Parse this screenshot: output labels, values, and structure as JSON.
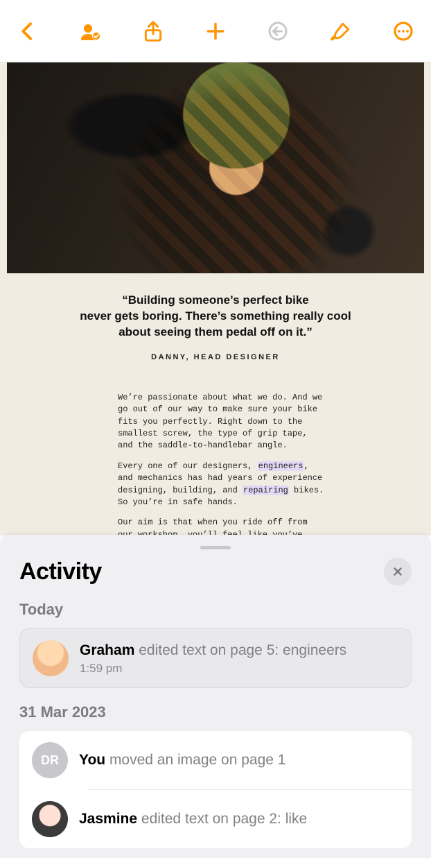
{
  "document": {
    "quote": {
      "line1": "“Building someone’s perfect bike",
      "line2": "never gets boring. There’s something really cool",
      "line3": "about seeing them pedal off on it.”",
      "attribution": "DANNY, HEAD DESIGNER"
    },
    "paragraphs": {
      "p1": "We’re passionate about what we do. And we go out of our way to make sure your bike fits you perfectly. Right down to the smallest screw, the type of grip tape, and the saddle-to-handlebar angle.",
      "p2_a": "Every one of our designers, ",
      "p2_hl1": "engineers",
      "p2_b": ", and mechanics has had years of experience designing, building, and ",
      "p2_hl2": "repairing",
      "p2_c": " bikes. So you’re in safe hands.",
      "p3": "Our aim is that when you ride off from our workshop, you’ll feel like you’ve known this bike all your life."
    }
  },
  "activity": {
    "title": "Activity",
    "sections": [
      {
        "label": "Today",
        "items": [
          {
            "who": "Graham",
            "action": " edited text on page 5: engineers",
            "time": "1:59 pm",
            "avatar": "graham",
            "selected": true
          }
        ]
      },
      {
        "label": "31 Mar 2023",
        "items": [
          {
            "who": "You",
            "action": " moved an image on page 1",
            "time": "",
            "avatar": "dr",
            "initials": "DR",
            "selected": false
          },
          {
            "who": "Jasmine",
            "action": " edited text on page 2: like",
            "time": "",
            "avatar": "jasmine",
            "selected": false
          }
        ]
      }
    ]
  }
}
